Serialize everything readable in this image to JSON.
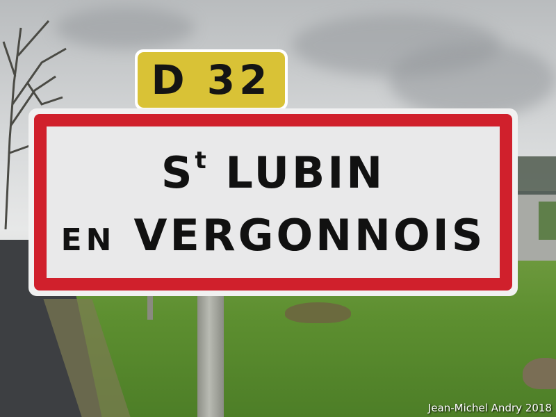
{
  "route_sign": {
    "text": "D 32"
  },
  "place_sign": {
    "line1_prefix": "S",
    "line1_superscript": "t",
    "line1_rest": " LUBIN",
    "line2_small": "EN",
    "line2_rest": "VERGONNOIS"
  },
  "credit": "Jean-Michel Andry 2018",
  "colors": {
    "sign_red": "#d0202c",
    "route_yellow": "#d9c236",
    "grass_green": "#5d8f30",
    "sky_gray": "#d8dadb"
  }
}
